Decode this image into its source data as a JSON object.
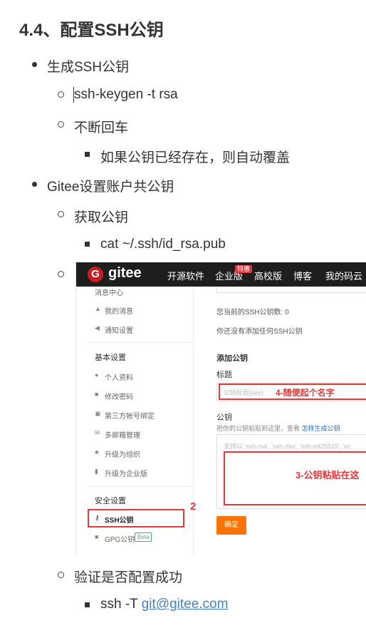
{
  "heading": "4.4、配置SSH公钥",
  "list": {
    "item1": "生成SSH公钥",
    "item1_cmd": "ssh-keygen -t rsa",
    "item1_enter": "不断回车",
    "item1_note": "如果公钥已经存在，则自动覆盖",
    "item2": "Gitee设置账户共公钥",
    "item2_get": "获取公钥",
    "item2_cmd": "cat ~/.ssh/id_rsa.pub",
    "item3": "验证是否配置成功",
    "item3_cmd_prefix": "ssh -T ",
    "item3_link": "git@gitee.com"
  },
  "screenshot": {
    "brand": "gitee",
    "nav": [
      "开源软件",
      "企业版",
      "高校版",
      "博客",
      "我的码云"
    ],
    "hot_badge": "特惠",
    "sidebar": {
      "msg_center": "消息中心",
      "my_messages": "我的消息",
      "notify_settings": "通知设置",
      "basic_settings": "基本设置",
      "profile": "个人资料",
      "change_password": "修改密码",
      "third_party": "第三方帐号绑定",
      "multi_email": "多邮箱管理",
      "upgrade_org": "升级为组织",
      "upgrade_enterprise": "升级为企业版",
      "security_settings": "安全设置",
      "ssh_keys": "SSH公钥",
      "gpg_keys": "GPG公钥",
      "beta": "Beta"
    },
    "main": {
      "key_count": "您当前的SSH公钥数: 0",
      "no_key": "你还没有添加任何SSH公钥",
      "add_key": "添加公钥",
      "title_label": "标题",
      "title_placeholder": "公钥标题(key)",
      "key_label": "公钥",
      "key_hint": "把你的公钥粘贴到这里，查看",
      "key_hint_link": "怎样生成公钥",
      "key_placeholder": "支持以 'ssh-rsa', 'ssh-dss', 'ssh-ed25519', 'ec",
      "confirm": "确定"
    },
    "annotations": {
      "a2": "2",
      "a4": "4-随便起个名字",
      "a3": "3-公钥粘贴在这"
    }
  }
}
